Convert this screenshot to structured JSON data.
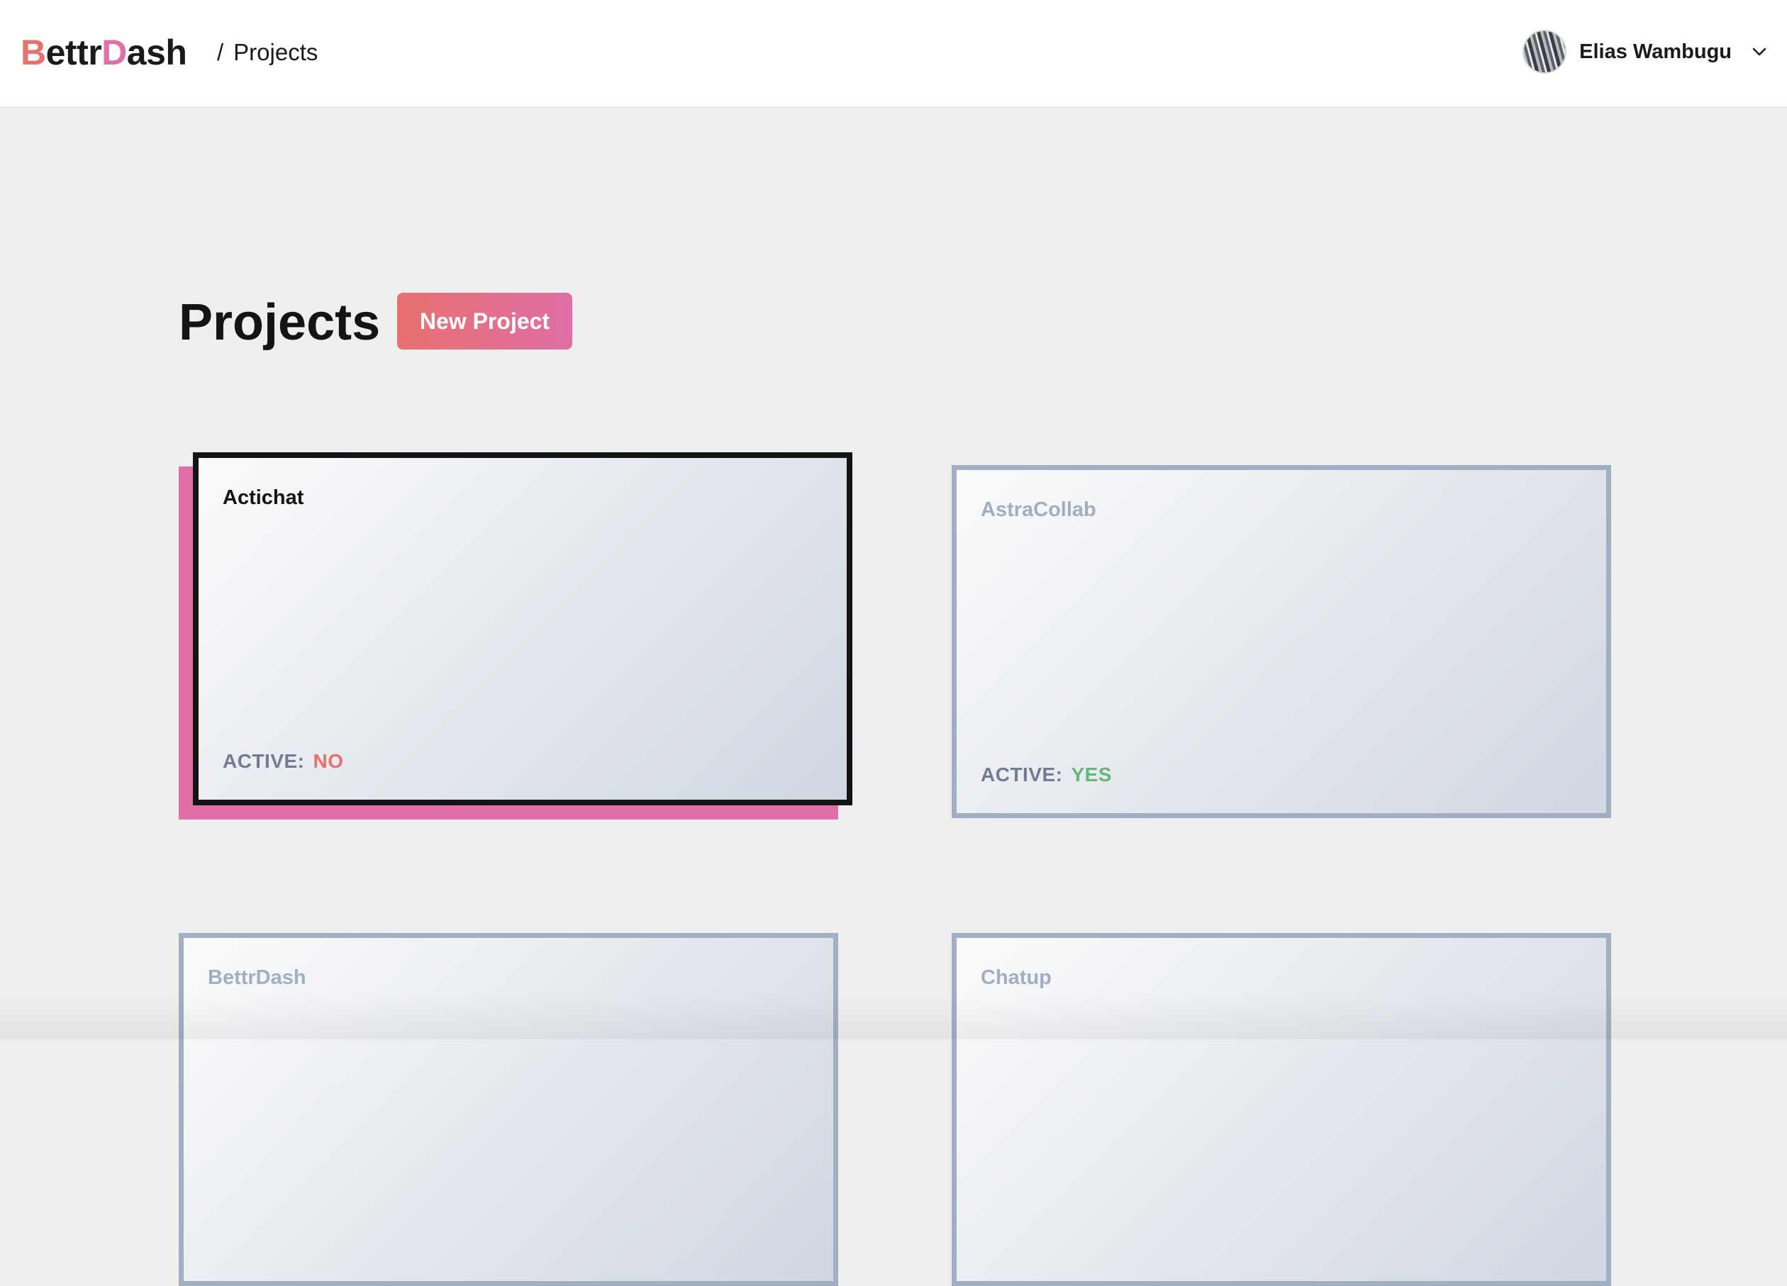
{
  "app": {
    "logo": {
      "b": "B",
      "ettr": "ettr",
      "d": "D",
      "ash": "ash"
    }
  },
  "breadcrumb": {
    "separator": "/",
    "current": "Projects"
  },
  "user": {
    "name": "Elias Wambugu"
  },
  "page": {
    "title": "Projects",
    "new_project_label": "New Project"
  },
  "projects": [
    {
      "name": "Actichat",
      "active_label": "ACTIVE:",
      "active_value": "NO",
      "selected": true
    },
    {
      "name": "AstraCollab",
      "active_label": "ACTIVE:",
      "active_value": "YES",
      "selected": false
    },
    {
      "name": "BettrDash"
    },
    {
      "name": "Chatup"
    }
  ],
  "colors": {
    "brand_coral": "#e8706f",
    "brand_pink": "#df6fa6",
    "status_no": "#e8706f",
    "status_yes": "#63b877",
    "card_border": "#a2afc3",
    "selected_border": "#141414"
  },
  "icons": {
    "user_menu": "chevron-down-icon"
  }
}
